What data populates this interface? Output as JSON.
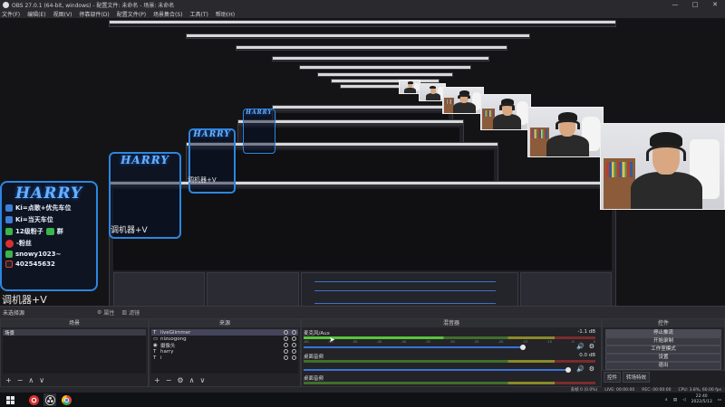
{
  "window": {
    "title": "OBS 27.0.1 (64-bit, windows) - 配置文件: 未命名 - 场景: 未命名",
    "controls": [
      "—",
      "□",
      "✕"
    ]
  },
  "menu": [
    "文件(F)",
    "编辑(E)",
    "视图(V)",
    "停靠部件(D)",
    "配置文件(P)",
    "场景集合(S)",
    "工具(T)",
    "帮助(H)"
  ],
  "overlay": {
    "logo": "HARRY",
    "rows": [
      {
        "icon": "qq-icon",
        "text": "Ki=点歌+优先车位",
        "color": "#3b7fd9"
      },
      {
        "icon": "qq-icon",
        "text": "Ki=当天车位",
        "color": "#3b7fd9"
      },
      {
        "icon": "wechat-icon",
        "text": "12级粉子",
        "extra": "群",
        "color": "#3ab54a"
      },
      {
        "icon": "weibo-icon",
        "text": "-粉丝",
        "color": "#d8302f"
      },
      {
        "icon": "wechat-icon",
        "text": "snowy1023~",
        "color": "#3ab54a"
      },
      {
        "icon": "douyin-icon",
        "text": "402545632",
        "color": "#d04040"
      }
    ],
    "caption": "调机器+V"
  },
  "scene_bar": {
    "label": "未选择源",
    "btn1": "属性",
    "btn2": "滤镜"
  },
  "scenes": {
    "title": "场景",
    "items": [
      "场景"
    ]
  },
  "sources": {
    "title": "来源",
    "items": [
      {
        "type": "T",
        "name": "liveGlimmer"
      },
      {
        "type": "▭",
        "name": "nizuogong"
      },
      {
        "type": "◉",
        "name": "摄像头"
      },
      {
        "type": "T",
        "name": "harry"
      },
      {
        "type": "T",
        "name": "i"
      }
    ]
  },
  "mixer": {
    "title": "混音器",
    "channels": [
      {
        "name": "麦克风/Aux",
        "db": "-1.1 dB",
        "live": true
      },
      {
        "name": "桌面音频",
        "db": "0.0 dB",
        "live": false
      },
      {
        "name": "桌面音频",
        "db": "",
        "live": false
      }
    ],
    "ticks": [
      "-60",
      "-55",
      "-50",
      "-45",
      "-40",
      "-35",
      "-30",
      "-25",
      "-20",
      "-15",
      "-10",
      "-5",
      "0"
    ]
  },
  "controls": {
    "title": "控件",
    "buttons": [
      "停止推流",
      "开始录制",
      "工作室模式",
      "设置",
      "退出"
    ],
    "tabs": [
      "控件",
      "转场特效"
    ]
  },
  "statusbar": [
    "丢帧 0 (0.0%)",
    "LIVE: 00:00:00",
    "REC: 00:00:00",
    "CPU: 3.8%, 60.00 fps"
  ],
  "taskbar": {
    "time": "22:40",
    "date": "2022/5/13"
  },
  "colors": {
    "accent": "#2d86e0",
    "meter_green": "#56c43a",
    "slider_blue": "#3a74d4"
  }
}
